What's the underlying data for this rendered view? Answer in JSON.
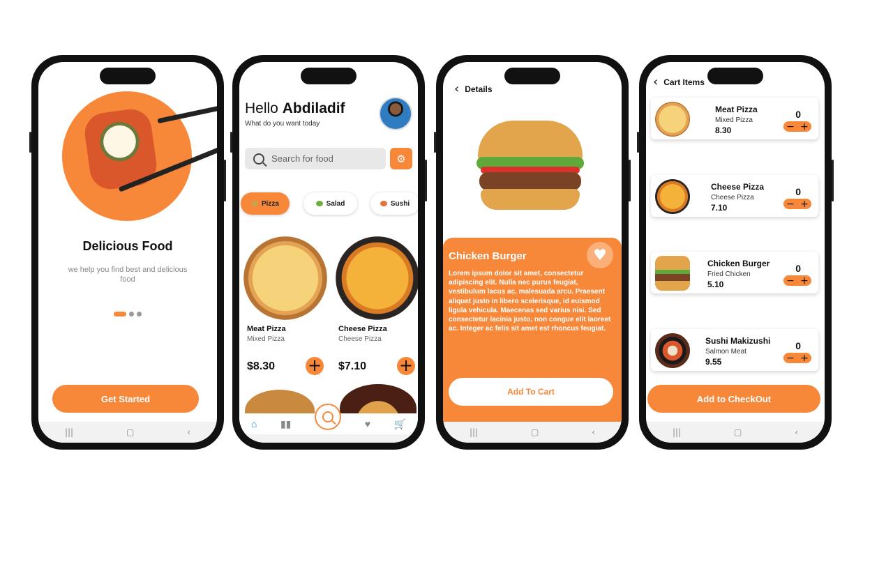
{
  "colors": {
    "accent": "#f7883a",
    "background": "#ffffff",
    "text": "#111111"
  },
  "screen1": {
    "title": "Delicious Food",
    "subtitle": "we help you find best and delicious food",
    "cta_label": "Get Started",
    "pagination": {
      "total": 3,
      "active": 1
    }
  },
  "screen2": {
    "greeting": "Hello",
    "username": "Abdiladif",
    "prompt": "What do you want today",
    "search_placeholder": "Search for food",
    "categories": [
      {
        "label": "Pizza",
        "active": true
      },
      {
        "label": "Salad",
        "active": false
      },
      {
        "label": "Sushi",
        "active": false
      }
    ],
    "products": [
      {
        "name": "Meat Pizza",
        "sub": "Mixed Pizza",
        "price": "$8.30"
      },
      {
        "name": "Cheese Pizza",
        "sub": "Cheese Pizza",
        "price": "$7.10"
      }
    ],
    "tabs": [
      "home-icon",
      "stats-icon",
      "search-icon",
      "heart-icon",
      "cart-icon"
    ]
  },
  "screen3": {
    "back_label": "Details",
    "title": "Chicken Burger",
    "description": "Lorem ipsum dolor sit amet, consectetur adipiscing elit. Nulla nec purus feugiat, vestibulum lacus ac, malesuada arcu. Praesent aliquet justo in libero scelerisque, id euismod ligula vehicula. Maecenas sed varius nisi. Sed consectetur lacinia justo, non congue elit laoreet ac. Integer ac felis sit amet est rhoncus feugiat.",
    "cta_label": "Add To Cart"
  },
  "screen4": {
    "back_label": "Cart Items",
    "items": [
      {
        "name": "Meat Pizza",
        "sub": "Mixed Pizza",
        "price": "8.30",
        "qty": "0"
      },
      {
        "name": "Cheese Pizza",
        "sub": "Cheese Pizza",
        "price": "7.10",
        "qty": "0"
      },
      {
        "name": "Chicken Burger",
        "sub": "Fried Chicken",
        "price": "5.10",
        "qty": "0"
      },
      {
        "name": "Sushi Makizushi",
        "sub": "Salmon Meat",
        "price": "9.55",
        "qty": "0"
      }
    ],
    "cta_label": "Add to CheckOut"
  }
}
